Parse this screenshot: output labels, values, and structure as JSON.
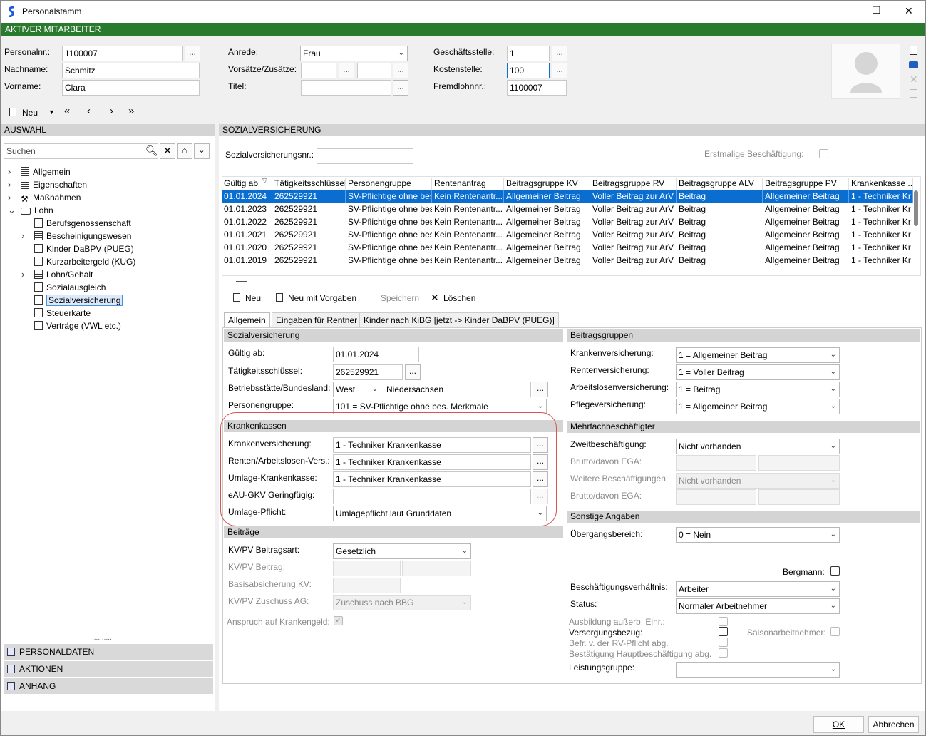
{
  "window": {
    "title": "Personalstamm",
    "minimize": "—",
    "maximize": "☐",
    "close": "✕"
  },
  "banner": "AKTIVER MITARBEITER",
  "header": {
    "personalnr_label": "Personalnr.:",
    "personalnr": "1100007",
    "nachname_label": "Nachname:",
    "nachname": "Schmitz",
    "vorname_label": "Vorname:",
    "vorname": "Clara",
    "anrede_label": "Anrede:",
    "anrede": "Frau",
    "vorsaetze_label": "Vorsätze/Zusätze:",
    "titel_label": "Titel:",
    "geschaeftsstelle_label": "Geschäftsstelle:",
    "geschaeftsstelle": "1",
    "kostenstelle_label": "Kostenstelle:",
    "kostenstelle": "100",
    "fremdlohn_label": "Fremdlohnnr.:",
    "fremdlohn": "1100007",
    "ellipsis": "..."
  },
  "nav": {
    "neu": "Neu",
    "first": "«",
    "prev": "‹",
    "next": "›",
    "last": "»"
  },
  "left": {
    "title": "AUSWAHL",
    "search_placeholder": "Suchen",
    "tree": [
      {
        "label": "Allgemein"
      },
      {
        "label": "Eigenschaften"
      },
      {
        "label": "Maßnahmen"
      },
      {
        "label": "Lohn"
      },
      {
        "label": "Berufsgenossenschaft"
      },
      {
        "label": "Bescheinigungswesen"
      },
      {
        "label": "Kinder DaBPV (PUEG)"
      },
      {
        "label": "Kurzarbeitergeld (KUG)"
      },
      {
        "label": "Lohn/Gehalt"
      },
      {
        "label": "Sozialausgleich"
      },
      {
        "label": "Sozialversicherung"
      },
      {
        "label": "Steuerkarte"
      },
      {
        "label": "Verträge (VWL etc.)"
      }
    ],
    "accordion": [
      "PERSONALDATEN",
      "AKTIONEN",
      "ANHANG"
    ]
  },
  "main": {
    "title": "SOZIALVERSICHERUNG",
    "svnr_label": "Sozialversicherungsnr.:",
    "erstmalig_label": "Erstmalige Beschäftigung:",
    "grid": {
      "headers": [
        "Gültig ab",
        "Tätigkeitsschlüssel",
        "Personengruppe",
        "Rentenantrag",
        "Beitragsgruppe KV",
        "Beitragsgruppe RV",
        "Beitragsgruppe ALV",
        "Beitragsgruppe PV",
        "Krankenkasse ..."
      ],
      "rows": [
        [
          "01.01.2024",
          "262529921",
          "SV-Pflichtige ohne bes",
          "Kein Rentenantr...",
          "Allgemeiner Beitrag",
          "Voller Beitrag zur ArV",
          "Beitrag",
          "Allgemeiner Beitrag",
          "1 - Techniker Kr"
        ],
        [
          "01.01.2023",
          "262529921",
          "SV-Pflichtige ohne bes",
          "Kein Rentenantr...",
          "Allgemeiner Beitrag",
          "Voller Beitrag zur ArV",
          "Beitrag",
          "Allgemeiner Beitrag",
          "1 - Techniker Kr"
        ],
        [
          "01.01.2022",
          "262529921",
          "SV-Pflichtige ohne bes",
          "Kein Rentenantr...",
          "Allgemeiner Beitrag",
          "Voller Beitrag zur ArV",
          "Beitrag",
          "Allgemeiner Beitrag",
          "1 - Techniker Kr"
        ],
        [
          "01.01.2021",
          "262529921",
          "SV-Pflichtige ohne bes",
          "Kein Rentenantr...",
          "Allgemeiner Beitrag",
          "Voller Beitrag zur ArV",
          "Beitrag",
          "Allgemeiner Beitrag",
          "1 - Techniker Kr"
        ],
        [
          "01.01.2020",
          "262529921",
          "SV-Pflichtige ohne bes",
          "Kein Rentenantr...",
          "Allgemeiner Beitrag",
          "Voller Beitrag zur ArV",
          "Beitrag",
          "Allgemeiner Beitrag",
          "1 - Techniker Kr"
        ],
        [
          "01.01.2019",
          "262529921",
          "SV-Pflichtige ohne bes",
          "Kein Rentenantr...",
          "Allgemeiner Beitrag",
          "Voller Beitrag zur ArV",
          "Beitrag",
          "Allgemeiner Beitrag",
          "1 - Techniker Kr"
        ]
      ]
    },
    "toolbar": {
      "neu": "Neu",
      "neu_vorgaben": "Neu mit Vorgaben",
      "speichern": "Speichern",
      "loeschen": "Löschen"
    },
    "tabs": [
      "Allgemein",
      "Eingaben für Rentner",
      "Kinder nach KiBG [jetzt -> Kinder DaBPV (PUEG)]"
    ],
    "sv": {
      "title": "Sozialversicherung",
      "gueltig_label": "Gültig ab:",
      "gueltig": "01.01.2024",
      "taetig_label": "Tätigkeitsschlüssel:",
      "taetig": "262529921",
      "betrieb_label": "Betriebsstätte/Bundesland:",
      "betrieb": "West",
      "bundesland": "Niedersachsen",
      "personen_label": "Personengruppe:",
      "personen": "101 = SV-Pflichtige ohne bes. Merkmale"
    },
    "kk": {
      "title": "Krankenkassen",
      "kv_label": "Krankenversicherung:",
      "kv": "1 - Techniker Krankenkasse",
      "rv_label": "Renten/Arbeitslosen-Vers.:",
      "rv": "1 - Techniker Krankenkasse",
      "umlage_label": "Umlage-Krankenkasse:",
      "umlage": "1 - Techniker Krankenkasse",
      "eau_label": "eAU-GKV Geringfügig:",
      "pflicht_label": "Umlage-Pflicht:",
      "pflicht": "Umlagepflicht laut Grunddaten"
    },
    "beitraege": {
      "title": "Beiträge",
      "art_label": "KV/PV Beitragsart:",
      "art": "Gesetzlich",
      "beitrag_label": "KV/PV Beitrag:",
      "basis_label": "Basisabsicherung KV:",
      "zuschuss_label": "KV/PV Zuschuss AG:",
      "zuschuss": "Zuschuss nach BBG",
      "anspruch_label": "Anspruch auf Krankengeld:"
    },
    "bg": {
      "title": "Beitragsgruppen",
      "kv_label": "Krankenversicherung:",
      "kv": "1 = Allgemeiner Beitrag",
      "rv_label": "Rentenversicherung:",
      "rv": "1 = Voller Beitrag",
      "alv_label": "Arbeitslosenversicherung:",
      "alv": "1 = Beitrag",
      "pv_label": "Pflegeversicherung:",
      "pv": "1 = Allgemeiner Beitrag"
    },
    "mehrfach": {
      "title": "Mehrfachbeschäftigter",
      "zweit_label": "Zweitbeschäftigung:",
      "zweit": "Nicht vorhanden",
      "brutto1_label": "Brutto/davon EGA:",
      "weitere_label": "Weitere Beschäftigungen:",
      "weitere": "Nicht vorhanden",
      "brutto2_label": "Brutto/davon EGA:"
    },
    "sonstige": {
      "title": "Sonstige Angaben",
      "uebergang_label": "Übergangsbereich:",
      "uebergang": "0 = Nein",
      "bergmann_label": "Bergmann:",
      "verhaeltnis_label": "Beschäftigungsverhältnis:",
      "verhaeltnis": "Arbeiter",
      "status_label": "Status:",
      "status": "Normaler Arbeitnehmer",
      "ausbildung_label": "Ausbildung außerb. Einr.:",
      "versorgung_label": "Versorgungsbezug:",
      "saison_label": "Saisonarbeitnehmer:",
      "befr_label": "Befr. v. der RV-Pflicht abg.",
      "bestaetigung_label": "Bestätigung Hauptbeschäftigung abg.",
      "leistung_label": "Leistungsgruppe:"
    }
  },
  "footer": {
    "ok": "OK",
    "abbrechen": "Abbrechen"
  },
  "colors": {
    "accent_green": "#2a7a2e",
    "selection_blue": "#0a6ed1",
    "highlight_red": "#d9534f"
  }
}
